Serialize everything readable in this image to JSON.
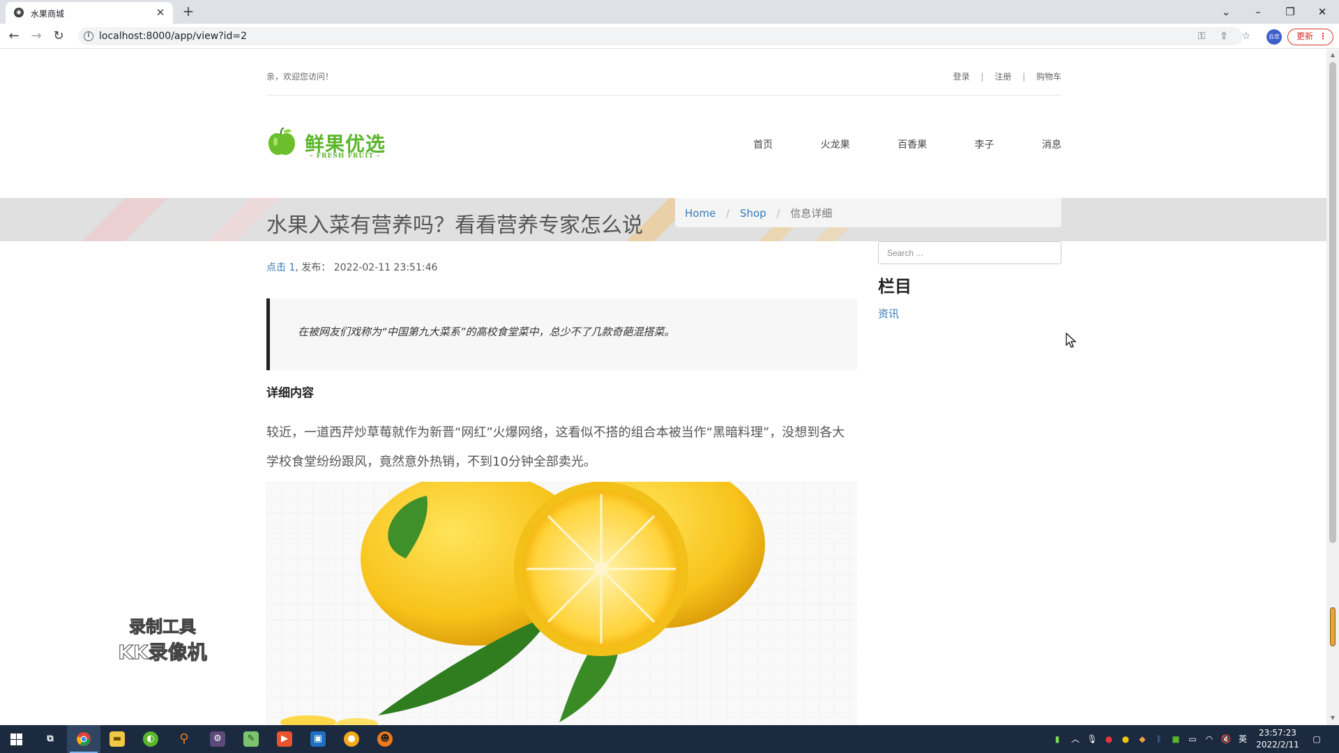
{
  "browser": {
    "tab_title": "水果商城",
    "url": "localhost:8000/app/view?id=2",
    "update_label": "更新",
    "avatar_text": "云忠"
  },
  "header": {
    "welcome": "亲，欢迎您访问！",
    "links": [
      "登录",
      "注册",
      "购物车"
    ],
    "separator": "|"
  },
  "logo": {
    "text": "鲜果优选",
    "subtext": "– FRESH FRUIT –"
  },
  "nav": [
    "首页",
    "火龙果",
    "百香果",
    "李子",
    "消息"
  ],
  "hero": {
    "title": "水果入菜有营养吗？看看营养专家怎么说"
  },
  "breadcrumb": {
    "items": [
      "Home",
      "Shop",
      "信息详细"
    ],
    "separator": "/"
  },
  "article": {
    "hits_label": "点击 1",
    "publish_label": ", 发布：",
    "publish_time": "2022-02-11 23:51:46",
    "quote": "在被网友们戏称为“中国第九大菜系”的高校食堂菜中，总少不了几款奇葩混搭菜。",
    "section_title": "详细内容",
    "body": "较近，一道西芹炒草莓就作为新晋“网红”火爆网络，这看似不搭的组合本被当作“黑暗料理”，没想到各大学校食堂纷纷跟风，竟然意外热销，不到10分钟全部卖光。"
  },
  "sidebar": {
    "search_placeholder": "Search ...",
    "heading": "栏目",
    "links": [
      "资讯"
    ]
  },
  "watermark": {
    "line1": "录制工具",
    "line2": "KK录像机"
  },
  "taskbar": {
    "time": "23:57:23",
    "date": "2022/2/11",
    "ime": "英",
    "apps": [
      "start-icon",
      "task-view-icon",
      "chrome-icon",
      "file-explorer-icon",
      "green-app-icon",
      "search-app-icon",
      "game-app-icon",
      "notepad-icon",
      "video-app-icon",
      "media-app-icon",
      "browser-app-icon",
      "face-app-icon"
    ]
  },
  "colors": {
    "brand_green": "#5ab52a",
    "link_blue": "#337ab7",
    "taskbar": "#1b2a3f"
  }
}
